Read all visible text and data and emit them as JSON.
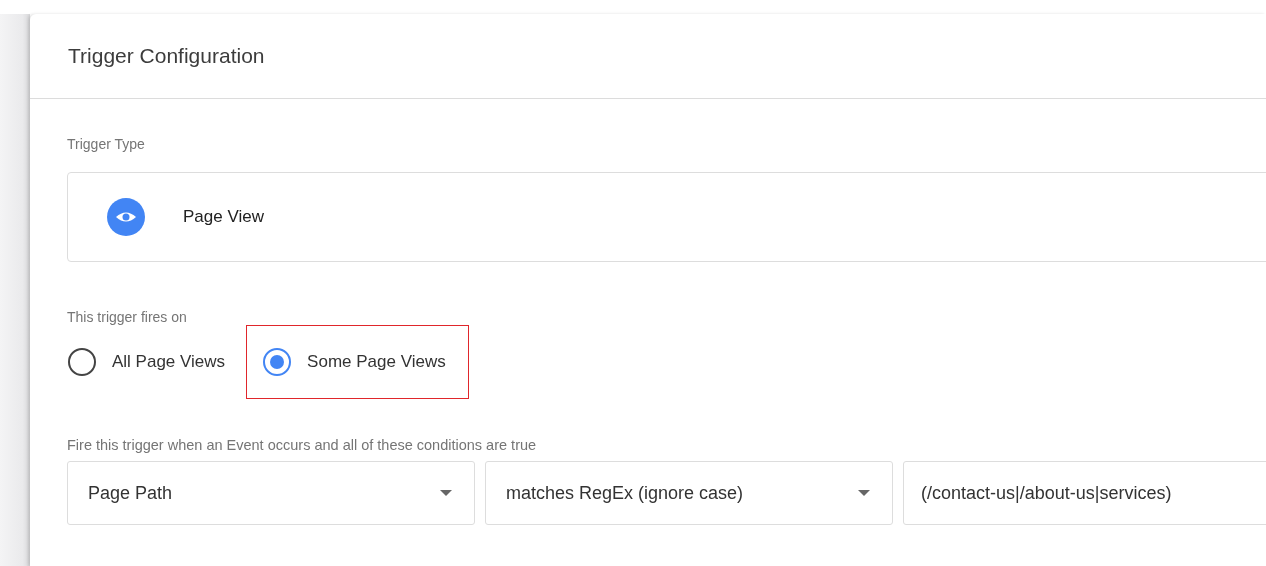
{
  "panel": {
    "title": "Trigger Configuration"
  },
  "trigger_type": {
    "label": "Trigger Type",
    "value": "Page View"
  },
  "fires_on": {
    "label": "This trigger fires on",
    "options": [
      {
        "label": "All Page Views",
        "selected": false,
        "highlighted": false
      },
      {
        "label": "Some Page Views",
        "selected": true,
        "highlighted": true
      }
    ]
  },
  "conditions": {
    "label": "Fire this trigger when an Event occurs and all of these conditions are true",
    "fields": [
      {
        "kind": "dropdown",
        "value": "Page Path"
      },
      {
        "kind": "dropdown",
        "value": "matches RegEx (ignore case)"
      },
      {
        "kind": "text",
        "value": "(/contact-us|/about-us|services)"
      }
    ]
  }
}
